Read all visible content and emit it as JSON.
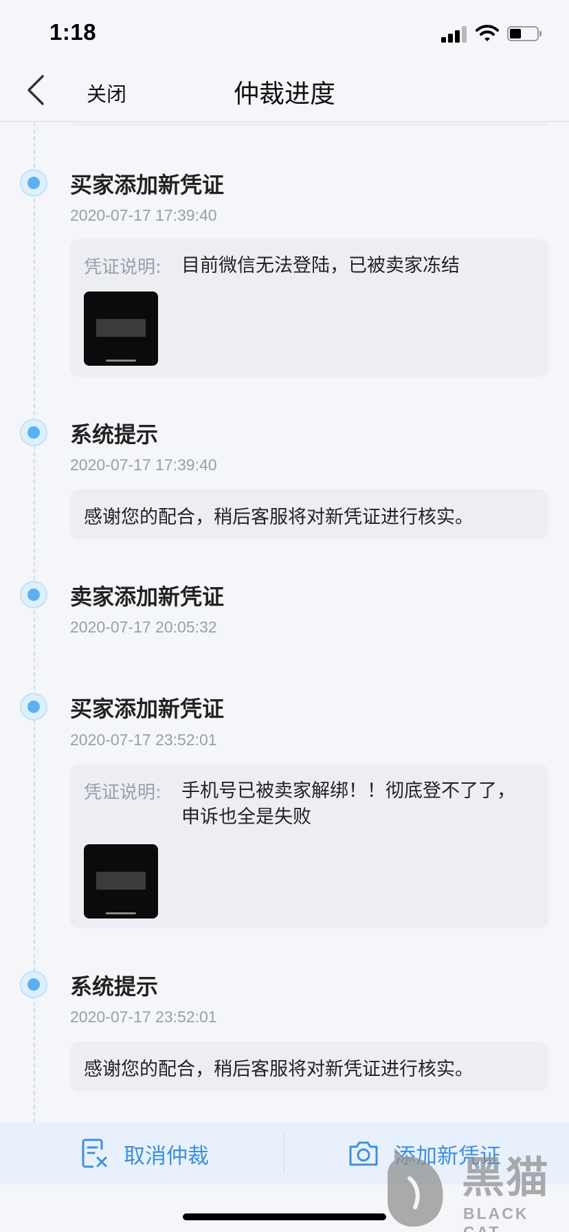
{
  "status_bar": {
    "time": "1:18",
    "icons": [
      "signal-icon",
      "wifi-icon",
      "battery-icon"
    ]
  },
  "nav": {
    "back_icon": "chevron-left-icon",
    "close_label": "关闭",
    "title": "仲裁进度"
  },
  "events": [
    {
      "title": "买家添加新凭证",
      "time": "2020-07-17 17:39:40",
      "card_label": "凭证说明:",
      "card_text": "目前微信无法登陆，已被卖家冻结",
      "has_thumbnail": true
    },
    {
      "title": "系统提示",
      "time": "2020-07-17 17:39:40",
      "card_message": "感谢您的配合，稍后客服将对新凭证进行核实。"
    },
    {
      "title": "卖家添加新凭证",
      "time": "2020-07-17 20:05:32"
    },
    {
      "title": "买家添加新凭证",
      "time": "2020-07-17 23:52:01",
      "card_label": "凭证说明:",
      "card_text": "手机号已被卖家解绑！！彻底登不了了，申诉也全是失败",
      "has_thumbnail": true
    },
    {
      "title": "系统提示",
      "time": "2020-07-17 23:52:01",
      "card_message": "感谢您的配合，稍后客服将对新凭证进行核实。"
    }
  ],
  "actions": {
    "cancel_label": "取消仲裁",
    "cancel_icon": "cancel-document-icon",
    "add_label": "添加新凭证",
    "add_icon": "camera-icon"
  },
  "watermark": {
    "cn": "黑猫",
    "en": "BLACK CAT"
  },
  "colors": {
    "accent": "#3c8fe0",
    "dot": "#58b1f2",
    "background": "#f4f6f9",
    "card": "#eceef3",
    "muted_text": "#9a9fa7"
  }
}
